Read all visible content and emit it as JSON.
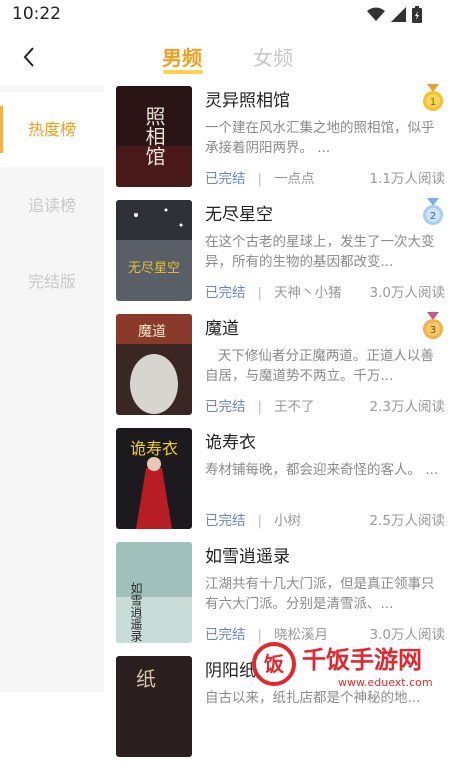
{
  "status_bar": {
    "time": "10:22"
  },
  "tabs": {
    "male": "男频",
    "female": "女频"
  },
  "sidebar": {
    "items": [
      {
        "label": "热度榜"
      },
      {
        "label": "追读榜"
      },
      {
        "label": "完结版"
      }
    ]
  },
  "books": [
    {
      "title": "灵异照相馆",
      "desc": "一个建在风水汇集之地的照相馆，似乎承接着阴阳两界。 ...",
      "status": "已完结",
      "author": "一点点",
      "reads": "1.1万人阅读",
      "rank": "1",
      "cover_text": "照相馆",
      "cover_color": "#2a1416"
    },
    {
      "title": "无尽星空",
      "desc": "在这个古老的星球上，发生了一次大变异，所有的生物的基因都改变...",
      "status": "已完结",
      "author": "天神丶小猪",
      "reads": "3.0万人阅读",
      "rank": "2",
      "cover_text": "无尽星空",
      "cover_color": "#6b6f78"
    },
    {
      "title": "魔道",
      "desc": "天下修仙者分正魔两道。正道人以善自居，与魔道势不两立。千万...",
      "status": "已完结",
      "author": "王不了",
      "reads": "2.3万人阅读",
      "rank": "3",
      "cover_text": "魔道",
      "cover_color": "#3a2622"
    },
    {
      "title": "诡寿衣",
      "desc": "寿材铺每晚，都会迎来奇怪的客人。 ...",
      "status": "已完结",
      "author": "小树",
      "reads": "2.5万人阅读",
      "rank": "",
      "cover_text": "诡寿衣",
      "cover_color": "#1c1a1e"
    },
    {
      "title": "如雪逍遥录",
      "desc": "江湖共有十几大门派，但是真正领事只有六大门派。分别是清雪派、...",
      "status": "已完结",
      "author": "晓松溪月",
      "reads": "3.0万人阅读",
      "rank": "",
      "cover_text": "如雪逍遥录",
      "cover_color": "#7fa8a5"
    },
    {
      "title": "阴阳纸",
      "desc": "自古以来，纸扎店都是个神秘的地...",
      "status": "",
      "author": "",
      "reads": "",
      "rank": "",
      "cover_text": "纸",
      "cover_color": "#2b1f1f"
    }
  ],
  "watermark": {
    "title": "千饭手游网",
    "url": "www.eduext.com"
  }
}
